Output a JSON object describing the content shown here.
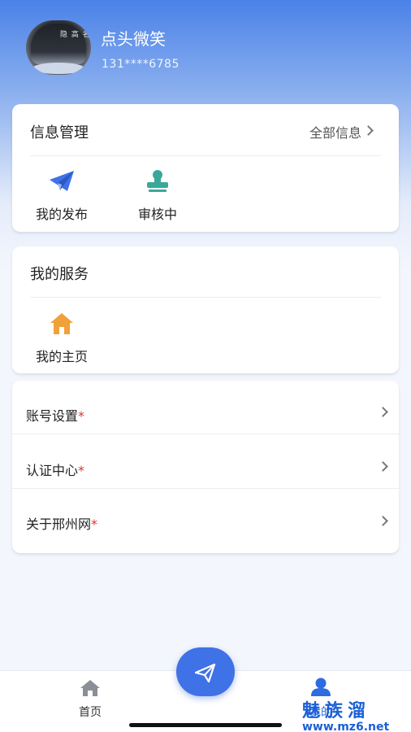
{
  "profile": {
    "name": "点头微笑",
    "phone": "131****6785",
    "avatar_text": "隐 高 名 婉 见 你"
  },
  "info_card": {
    "title": "信息管理",
    "link_label": "全部信息",
    "items": [
      {
        "label": "我的发布",
        "icon": "paper-plane-icon"
      },
      {
        "label": "审核中",
        "icon": "stamp-icon"
      }
    ]
  },
  "service_card": {
    "title": "我的服务",
    "items": [
      {
        "label": "我的主页",
        "icon": "house-icon"
      }
    ]
  },
  "settings": {
    "rows": [
      {
        "label": "账号设置",
        "star": "*"
      },
      {
        "label": "认证中心",
        "star": "*"
      },
      {
        "label": "关于邢州网",
        "star": "*"
      }
    ]
  },
  "tabbar": {
    "home_label": "首页",
    "mine_label": "我的"
  },
  "watermark": {
    "main": "魅族溜",
    "url": "www.mz6.net"
  },
  "colors": {
    "accent": "#3f72e6",
    "stamp": "#3aa899",
    "house": "#f0a13a",
    "required": "#d83a2f"
  }
}
